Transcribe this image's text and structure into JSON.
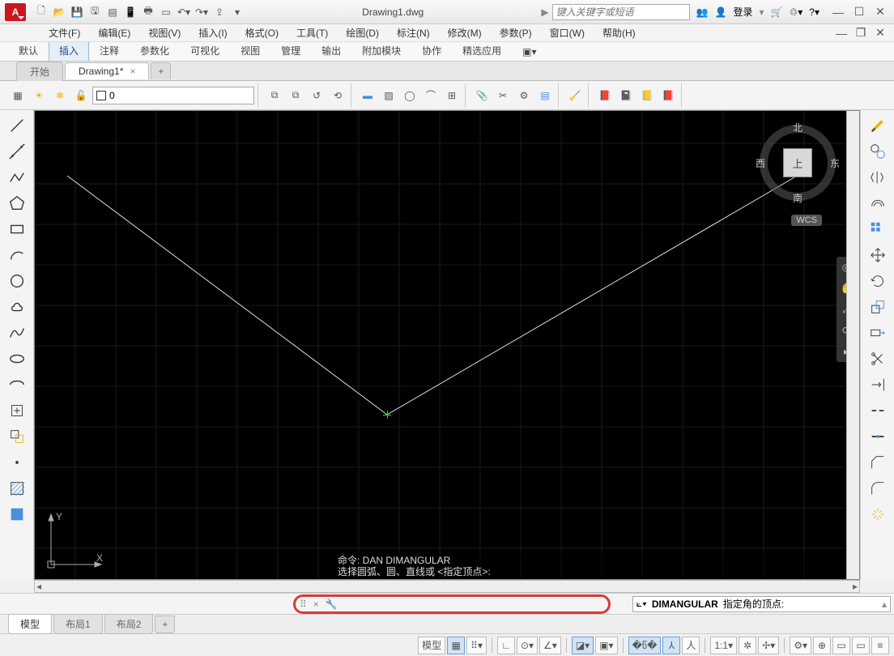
{
  "app": {
    "letter": "A",
    "title": "Drawing1.dwg",
    "search_placeholder": "键入关键字或短语",
    "login": "登录"
  },
  "menus": [
    "文件(F)",
    "编辑(E)",
    "视图(V)",
    "插入(I)",
    "格式(O)",
    "工具(T)",
    "绘图(D)",
    "标注(N)",
    "修改(M)",
    "参数(P)",
    "窗口(W)",
    "帮助(H)"
  ],
  "ribbon_tabs": [
    "默认",
    "插入",
    "注释",
    "参数化",
    "可视化",
    "视图",
    "管理",
    "输出",
    "附加模块",
    "协作",
    "精选应用"
  ],
  "ribbon_active": 1,
  "doc_tabs": {
    "start": "开始",
    "drawing": "Drawing1*",
    "add": "+"
  },
  "layer": {
    "name": "0"
  },
  "viewcube": {
    "top": "上",
    "n": "北",
    "s": "南",
    "e": "东",
    "w": "西",
    "wcs": "WCS"
  },
  "ucs": {
    "x": "X",
    "y": "Y"
  },
  "cmd_history": {
    "l1": "命令: DAN DIMANGULAR",
    "l2": "选择圆弧、圆、直线或 <指定顶点>:"
  },
  "cmd_line": {
    "cmd": "DIMANGULAR",
    "prompt": "指定角的顶点:"
  },
  "layout_tabs": [
    "模型",
    "布局1",
    "布局2"
  ],
  "status": {
    "model": "模型",
    "scale": "1:1"
  }
}
